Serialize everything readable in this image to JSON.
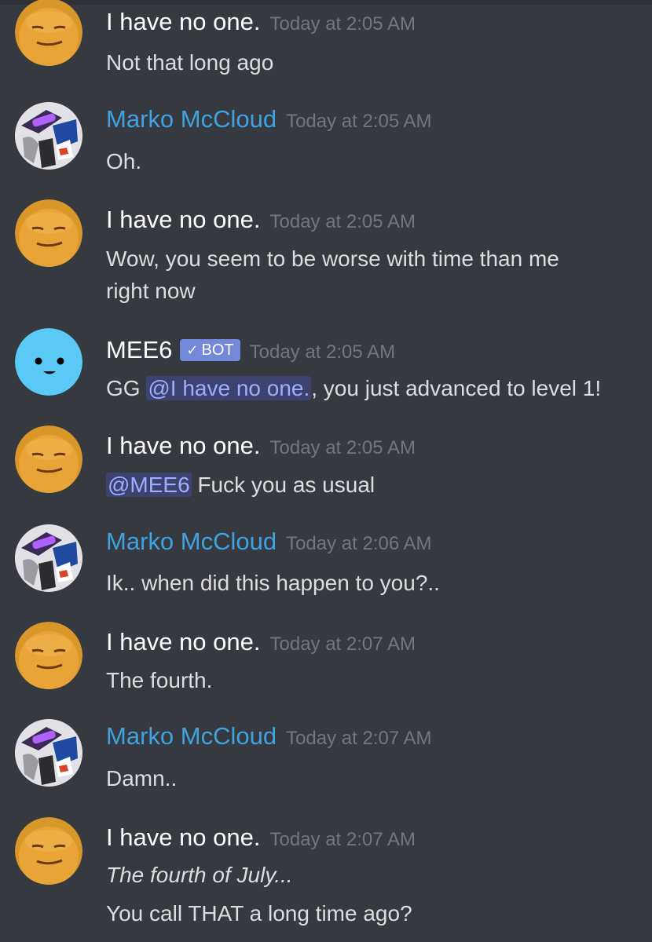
{
  "colors": {
    "background": "#36393f",
    "username_default": "#ffffff",
    "username_blue": "#3ea3e0",
    "timestamp": "#72767d",
    "message_text": "#dcddde",
    "mention_bg": "#3d4270",
    "mention_text": "#a0aeff",
    "bot_tag": "#7289da"
  },
  "messages": [
    {
      "user": "I have no one.",
      "avatar": "orange-face-avatar",
      "time": "Today at 2:05 AM",
      "lines": [
        "Not that long ago"
      ]
    },
    {
      "user": "Marko McCloud",
      "avatar": "robot-character-avatar",
      "time": "Today at 2:05 AM",
      "lines": [
        "Oh."
      ]
    },
    {
      "user": "I have no one.",
      "avatar": "orange-face-avatar",
      "time": "Today at 2:05 AM",
      "lines": [
        "Wow, you seem to be worse with time than me",
        "right now"
      ]
    },
    {
      "user": "MEE6",
      "avatar": "mee6-face-avatar",
      "bot_tag": "BOT",
      "time": "Today at 2:05 AM",
      "text_prefix": "GG ",
      "mention": "@I have no one.",
      "text_suffix": ", you just advanced to level 1!"
    },
    {
      "user": "I have no one.",
      "avatar": "orange-face-avatar",
      "time": "Today at 2:05 AM",
      "mention": "@MEE6",
      "text_suffix": " Fuck you as usual"
    },
    {
      "user": "Marko McCloud",
      "avatar": "robot-character-avatar",
      "time": "Today at 2:06 AM",
      "lines": [
        "Ik.. when did this happen to you?.."
      ]
    },
    {
      "user": "I have no one.",
      "avatar": "orange-face-avatar",
      "time": "Today at 2:07 AM",
      "lines": [
        "The fourth."
      ]
    },
    {
      "user": "Marko McCloud",
      "avatar": "robot-character-avatar",
      "time": "Today at 2:07 AM",
      "lines": [
        "Damn.."
      ]
    },
    {
      "user": "I have no one.",
      "avatar": "orange-face-avatar",
      "time": "Today at 2:07 AM",
      "italic_line": "The fourth of July...",
      "lines": [
        "You call THAT a long time ago?"
      ]
    }
  ]
}
